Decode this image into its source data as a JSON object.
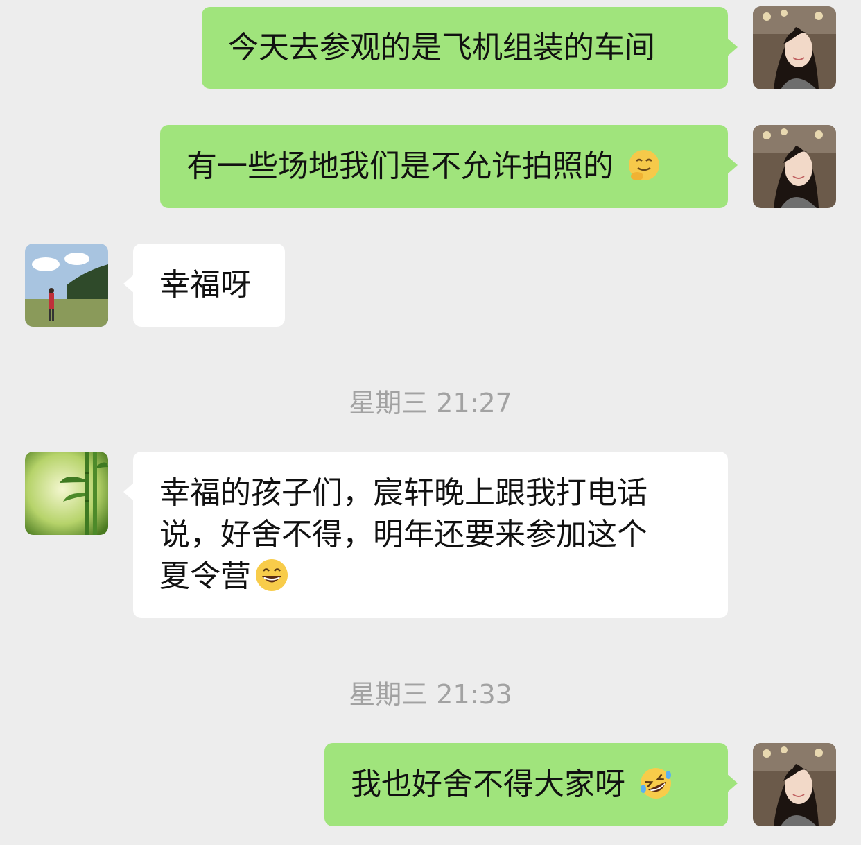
{
  "messages": [
    {
      "id": "m1",
      "side": "out",
      "text": "今天去参观的是飞机组装的车间",
      "emoji": ""
    },
    {
      "id": "m2",
      "side": "out",
      "text": "有一些场地我们是不允许拍照的",
      "emoji": "thinking-laugh-emoji"
    },
    {
      "id": "m3",
      "side": "in",
      "text": "幸福呀",
      "emoji": ""
    },
    {
      "id": "m4",
      "side": "in",
      "lines": [
        "幸福的孩子们，宸轩晚上跟我打电话",
        "说，好舍不得，明年还要来参加这个",
        "夏令营"
      ],
      "emoji": "grinning-emoji"
    },
    {
      "id": "m5",
      "side": "out",
      "text": "我也好舍不得大家呀",
      "emoji": "rofl-emoji"
    }
  ],
  "timestamps": [
    "星期三 21:27",
    "星期三 21:33"
  ],
  "colors": {
    "background": "#ededed",
    "outgoing": "#a0e47c",
    "incoming": "#ffffff",
    "timestamp": "#a2a2a2"
  }
}
